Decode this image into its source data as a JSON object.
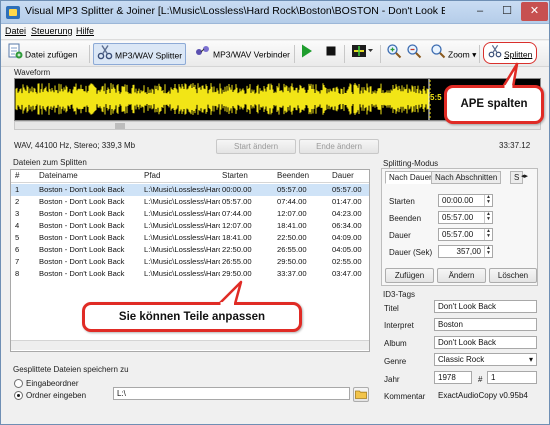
{
  "window": {
    "title": "Visual MP3 Splitter & Joiner [L:\\Music\\Lossless\\Hard Rock\\Boston\\BOSTON - Don't Look Ba...",
    "minimize_label": "–",
    "maximize_label": "☐",
    "close_label": "✕"
  },
  "menu": [
    "Datei",
    "Steuerung",
    "Hilfe"
  ],
  "toolbar": {
    "add_files": "Datei zufügen",
    "mp3_wav_splitter": "MP3/WAV Splitter",
    "mp3_wav_joiner": "MP3/WAV Verbinder",
    "zoom": "Zoom",
    "split": "Splitten"
  },
  "waveform": {
    "label": "Waveform",
    "position_text": "5:5",
    "format_info": "WAV, 44100 Hz, Stereo; 339,3 Mb",
    "start_change": "Start ändern",
    "end_change": "Ende ändern",
    "total_time": "33:37.12",
    "wave_color": "#f2e516",
    "bg_color": "#000000"
  },
  "files": {
    "label": "Dateien zum Splitten",
    "columns": [
      "#",
      "Dateiname",
      "Pfad",
      "Starten",
      "Beenden",
      "Dauer"
    ],
    "rows": [
      [
        "1",
        "Boston - Don't Look Back",
        "L:\\Music\\Lossless\\Hard Rock\\Boston\\",
        "00:00.00",
        "05:57.00",
        "05:57.00"
      ],
      [
        "2",
        "Boston - Don't Look Back",
        "L:\\Music\\Lossless\\Hard Rock\\Boston\\",
        "05:57.00",
        "07:44.00",
        "01:47.00"
      ],
      [
        "3",
        "Boston - Don't Look Back",
        "L:\\Music\\Lossless\\Hard Rock\\Boston\\",
        "07:44.00",
        "12:07.00",
        "04:23.00"
      ],
      [
        "4",
        "Boston - Don't Look Back",
        "L:\\Music\\Lossless\\Hard Rock\\Boston\\",
        "12:07.00",
        "18:41.00",
        "06:34.00"
      ],
      [
        "5",
        "Boston - Don't Look Back",
        "L:\\Music\\Lossless\\Hard Rock\\Boston\\",
        "18:41.00",
        "22:50.00",
        "04:09.00"
      ],
      [
        "6",
        "Boston - Don't Look Back",
        "L:\\Music\\Lossless\\Hard Rock\\Boston\\",
        "22:50.00",
        "26:55.00",
        "04:05.00"
      ],
      [
        "7",
        "Boston - Don't Look Back",
        "L:\\Music\\Lossless\\Hard Rock\\Boston\\",
        "26:55.00",
        "29:50.00",
        "02:55.00"
      ],
      [
        "8",
        "Boston - Don't Look Back",
        "L:\\Music\\Lossless\\Hard Rock\\Boston\\",
        "29:50.00",
        "33:37.00",
        "03:47.00"
      ]
    ]
  },
  "splitting": {
    "label": "Splitting-Modus",
    "tabs": [
      "Nach Dauer",
      "Nach Abschnitten",
      "S"
    ],
    "start_label": "Starten",
    "start_value": "00:00.00",
    "end_label": "Beenden",
    "end_value": "05:57.00",
    "duration_label": "Dauer",
    "duration_value": "05:57.00",
    "duration_sec_label": "Dauer (Sek)",
    "duration_sec_value": "357,00",
    "add_button": "Zufügen",
    "change_button": "Ändern",
    "delete_button": "Löschen"
  },
  "id3": {
    "label": "ID3-Tags",
    "title_label": "Titel",
    "title_value": "Don't Look Back",
    "artist_label": "Interpret",
    "artist_value": "Boston",
    "album_label": "Album",
    "album_value": "Don't Look Back",
    "genre_label": "Genre",
    "genre_value": "Classic Rock",
    "year_label": "Jahr",
    "year_value": "1978",
    "track_label": "#",
    "track_value": "1",
    "comment_label": "Kommentar",
    "comment_value": "ExactAudioCopy v0.95b4"
  },
  "save": {
    "label": "Gesplittete Dateien speichern zu",
    "option_input_folder": "Eingabeordner",
    "option_custom_folder": "Ordner eingeben",
    "folder_value": "L:\\"
  },
  "callouts": {
    "ape_split": "APE spalten",
    "edit_parts": "Sie können Teile anpassen"
  },
  "colors": {
    "callout_border": "#e02b25",
    "selection": "#cfe3f7",
    "play_green": "#1f9d2e"
  }
}
